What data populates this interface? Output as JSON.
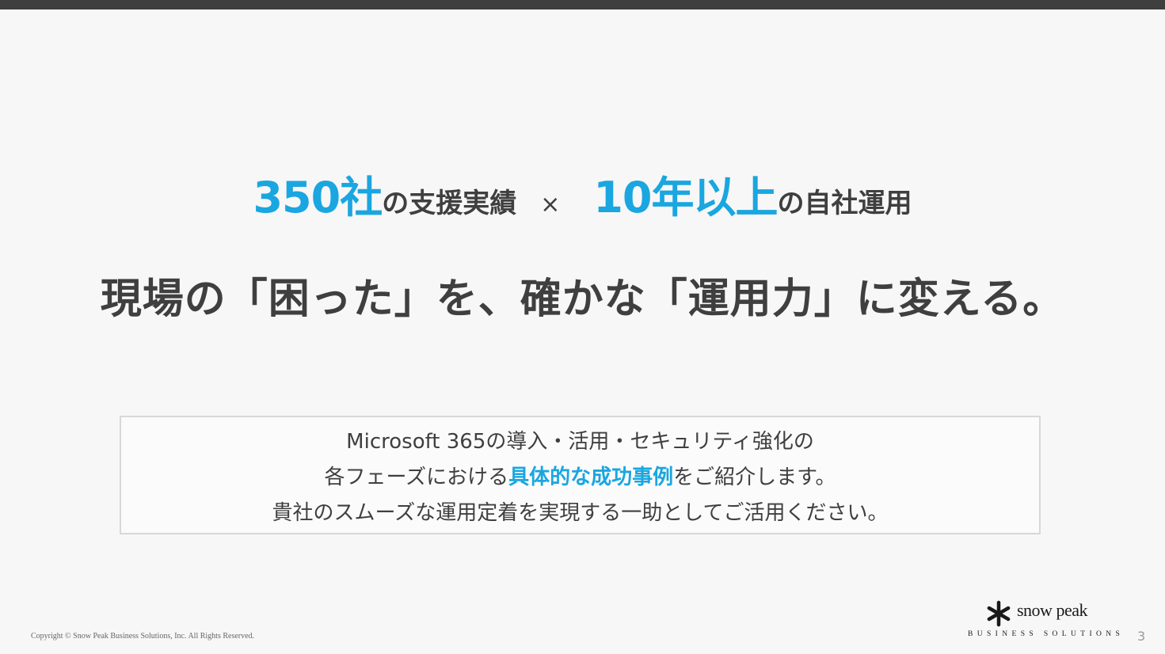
{
  "headline": {
    "count_value": "350社",
    "count_suffix": "の支援実績",
    "separator": "×",
    "years_value": "10年以上",
    "years_suffix": "の自社運用"
  },
  "tagline": "現場の「困った」を、確かな「運用力」に変える。",
  "intro": {
    "line1": "Microsoft 365の導入・活用・セキュリティ強化の",
    "line2_before": "各フェーズにおける",
    "line2_highlight": "具体的な成功事例",
    "line2_after": "をご紹介します。",
    "line3": "貴社のスムーズな運用定着を実現する一助としてご活用ください。"
  },
  "footer": {
    "copyright": "Copyright © Snow Peak Business Solutions, Inc. All Rights Reserved.",
    "logo_brand": "snow peak",
    "logo_sub": "BUSINESS SOLUTIONS",
    "page_number": "3"
  },
  "colors": {
    "accent": "#1aa6e0",
    "text": "#3f3f3f",
    "top_bar": "#3f3f3f",
    "background": "#f7f7f7"
  },
  "icons": {
    "logo_mark": "snowflake-asterisk-icon"
  }
}
